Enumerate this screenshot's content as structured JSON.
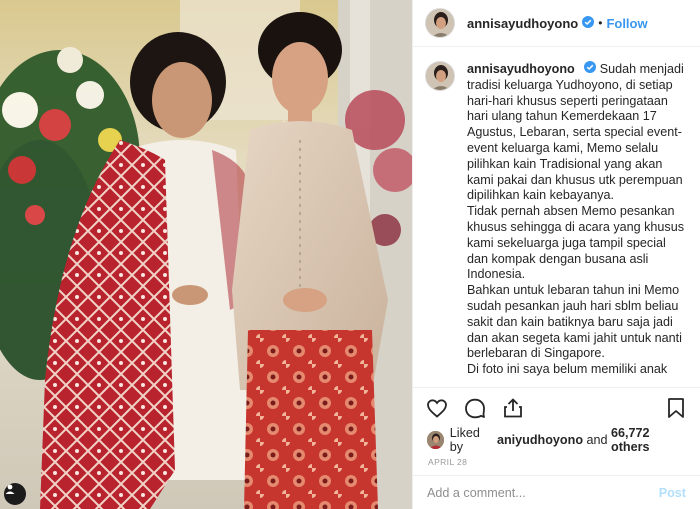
{
  "post": {
    "username": "annisayudhoyono",
    "follow_label": "Follow",
    "dot": "•",
    "caption_paragraphs": [
      "Sudah menjadi tradisi keluarga Yudhoyono, di setiap hari-hari khusus seperti peringataan hari ulang tahun Kemerdekaan 17 Agustus, Lebaran, serta special event-event keluarga kami, Memo selalu pilihkan kain Tradisional yang akan kami pakai dan khusus utk perempuan dipilihkan kain kebayanya.",
      "Tidak pernah absen Memo pesankan khusus sehingga di acara yang khusus kami sekeluarga juga tampil special dan kompak dengan busana asli Indonesia.",
      "Bahkan untuk lebaran tahun ini Memo sudah pesankan jauh hari sblm beliau sakit dan kain batiknya baru saja jadi dan akan segeta kami jahit untuk nanti berlebaran di Singapore.",
      "Di foto ini saya belum memiliki anak"
    ],
    "likes": {
      "prefix": "Liked by",
      "user": "aniyudhoyono",
      "connector": "and",
      "count": "66,772 others"
    },
    "date": "APRIL 28",
    "comment_placeholder": "Add a comment...",
    "post_label": "Post",
    "colors": {
      "accent": "#3897f0",
      "verified": "#3897f0",
      "post_disabled": "#b2dffc",
      "border": "#efefef"
    },
    "icons": [
      "verified-badge-icon",
      "heart-icon",
      "comment-icon",
      "share-icon",
      "bookmark-icon",
      "user-tag-icon"
    ]
  }
}
